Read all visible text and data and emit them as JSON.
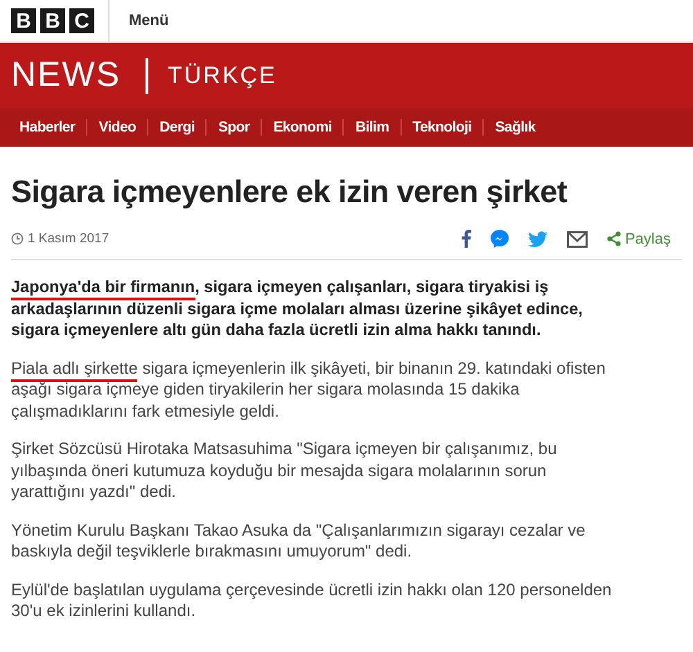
{
  "top_bar": {
    "logo_letters": [
      "B",
      "B",
      "C"
    ],
    "menu": "Menü"
  },
  "brand": {
    "name": "NEWS",
    "edition": "TÜRKÇE"
  },
  "nav": [
    {
      "label": "Haberler"
    },
    {
      "label": "Video"
    },
    {
      "label": "Dergi"
    },
    {
      "label": "Spor"
    },
    {
      "label": "Ekonomi"
    },
    {
      "label": "Bilim"
    },
    {
      "label": "Teknoloji"
    },
    {
      "label": "Sağlık"
    }
  ],
  "headline": "Sigara içmeyenlere ek izin veren şirket",
  "date": "1 Kasım 2017",
  "share": {
    "label": "Paylaş"
  },
  "paragraphs": [
    {
      "kind": "lead",
      "segments": [
        {
          "text": "Japonya'da bir firmanın",
          "marked": true
        },
        {
          "text": ", sigara içmeyen çalışanları, sigara tiryakisi iş arkadaşlarının düzenli sigara içme molaları alması üzerine şikâyet edince, sigara içmeyenlere altı gün daha fazla ücretli izin alma hakkı tanındı.",
          "marked": false
        }
      ]
    },
    {
      "kind": "body",
      "segments": [
        {
          "text": "Piala adlı şirkette",
          "marked": true
        },
        {
          "text": " sigara içmeyenlerin ilk şikâyeti, bir binanın 29. katındaki ofisten aşağı sigara içmeye giden tiryakilerin her sigara molasında 15 dakika çalışmadıklarını fark etmesiyle geldi.",
          "marked": false
        }
      ]
    },
    {
      "kind": "body",
      "segments": [
        {
          "text": "Şirket Sözcüsü Hirotaka Matsasuhima \"Sigara içmeyen bir çalışanımız, bu yılbaşında öneri kutumuza koyduğu bir mesajda sigara molalarının sorun yarattığını yazdı\" dedi.",
          "marked": false
        }
      ]
    },
    {
      "kind": "body",
      "segments": [
        {
          "text": "Yönetim Kurulu Başkanı Takao Asuka da \"Çalışanlarımızın sigarayı cezalar ve baskıyla değil teşviklerle bırakmasını umuyorum\" dedi.",
          "marked": false
        }
      ]
    },
    {
      "kind": "body",
      "segments": [
        {
          "text": "Eylül'de başlatılan uygulama çerçevesinde ücretli izin hakkı olan 120 personelden 30'u ek izinlerini kullandı.",
          "marked": false
        }
      ]
    }
  ]
}
